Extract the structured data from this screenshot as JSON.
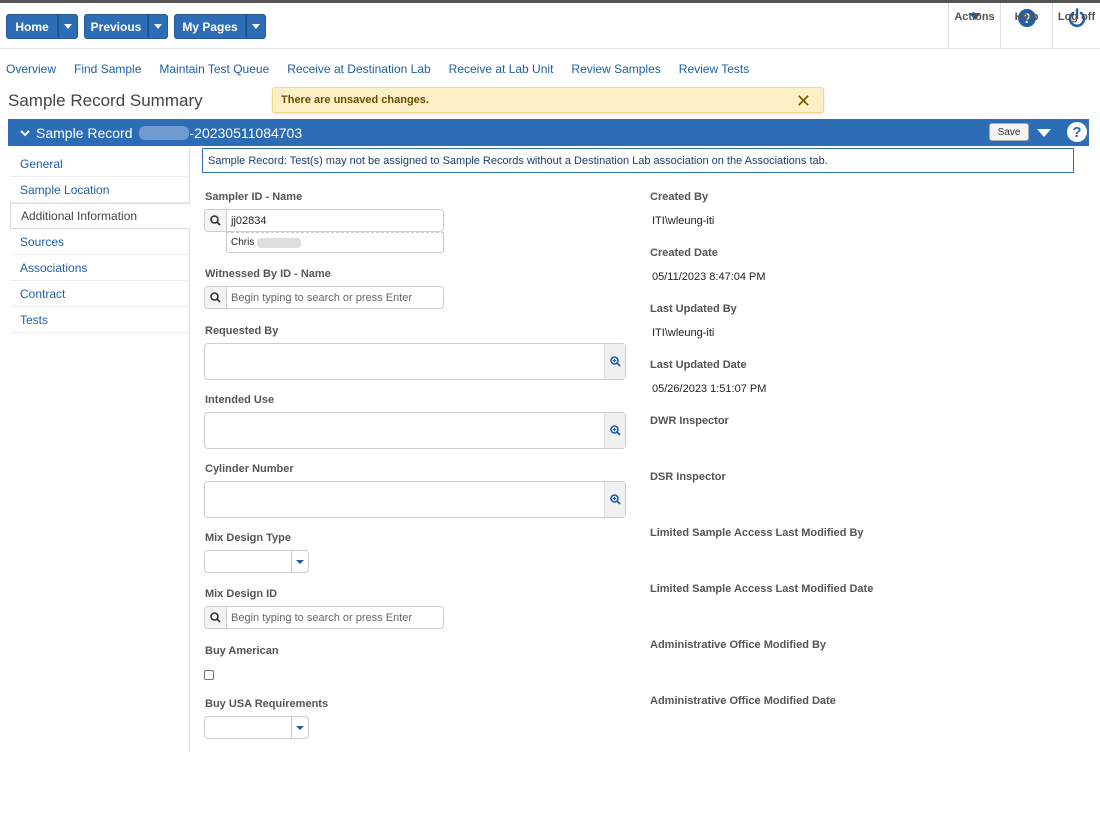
{
  "topbar": {
    "home_label": "Home",
    "previous_label": "Previous",
    "mypages_label": "My Pages",
    "actions_label": "Actions",
    "help_label": "Help",
    "logoff_label": "Log off"
  },
  "nav": {
    "links": [
      "Overview",
      "Find Sample",
      "Maintain Test Queue",
      "Receive at Destination Lab",
      "Receive at Lab Unit",
      "Review Samples",
      "Review Tests"
    ]
  },
  "page": {
    "title": "Sample Record Summary",
    "unsaved_message": "There are unsaved changes.",
    "close_glyph": "✕"
  },
  "record_bar": {
    "title": "Sample Record",
    "record_id_suffix": "-20230511084703",
    "save_label": "Save",
    "help_glyph": "?"
  },
  "sidebar": {
    "items": [
      "General",
      "Sample Location",
      "Additional Information",
      "Sources",
      "Associations",
      "Contract",
      "Tests"
    ],
    "active_index": 2
  },
  "info_banner": "Sample Record: Test(s) may not be assigned to Sample Records without a Destination Lab association on the Associations tab.",
  "form": {
    "sampler_label": "Sampler ID - Name",
    "sampler_value": "jj02834",
    "sampler_suggestion": "Chris",
    "witnessed_label": "Witnessed By ID - Name",
    "search_placeholder": "Begin typing to search or press Enter",
    "requested_label": "Requested By",
    "intended_label": "Intended Use",
    "cylinder_label": "Cylinder Number",
    "mix_type_label": "Mix Design Type",
    "mix_id_label": "Mix Design ID",
    "buy_american_label": "Buy American",
    "buy_usa_label": "Buy USA Requirements"
  },
  "details": {
    "created_by_label": "Created By",
    "created_by_value": "ITI\\wleung-iti",
    "created_date_label": "Created Date",
    "created_date_value": "05/11/2023 8:47:04 PM",
    "last_updated_by_label": "Last Updated By",
    "last_updated_by_value": "ITI\\wleung-iti",
    "last_updated_date_label": "Last Updated Date",
    "last_updated_date_value": "05/26/2023 1:51:07 PM",
    "dwr_label": "DWR Inspector",
    "dsr_label": "DSR Inspector",
    "lsa_by_label": "Limited Sample Access Last Modified By",
    "lsa_date_label": "Limited Sample Access Last Modified Date",
    "admin_by_label": "Administrative Office Modified By",
    "admin_date_label": "Administrative Office Modified Date"
  },
  "colors": {
    "primary": "#2d6db5",
    "link": "#1f5ea8",
    "warning_bg": "#fdf0c7"
  }
}
